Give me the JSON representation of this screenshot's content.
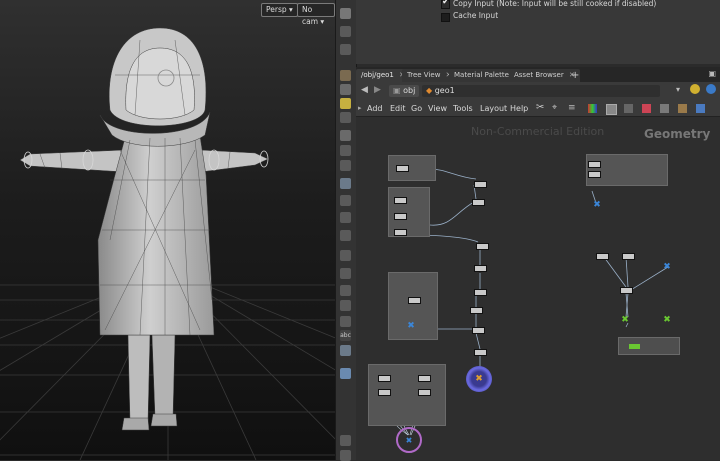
{
  "viewport": {
    "persp_label": "Persp",
    "cam_label": "No cam"
  },
  "params": {
    "copy_input_label": "Copy Input (Note: Input will be still cooked if disabled)",
    "cache_input_label": "Cache Input"
  },
  "tabs": [
    {
      "label": "/obj/geo1",
      "active": true
    },
    {
      "label": "Tree View"
    },
    {
      "label": "Material Palette"
    },
    {
      "label": "Asset Browser"
    }
  ],
  "path": {
    "obj": "obj",
    "geo": "geo1"
  },
  "menu": [
    "Add",
    "Edit",
    "Go",
    "View",
    "Tools",
    "Layout",
    "Help"
  ],
  "network": {
    "watermark": "Non-Commercial Edition",
    "context_label": "Geometry"
  },
  "colors": {
    "accent_purple": "#b06ac8",
    "node_blue": "#3b86d8",
    "node_green": "#6ac832",
    "output_orange": "#e0a030"
  }
}
